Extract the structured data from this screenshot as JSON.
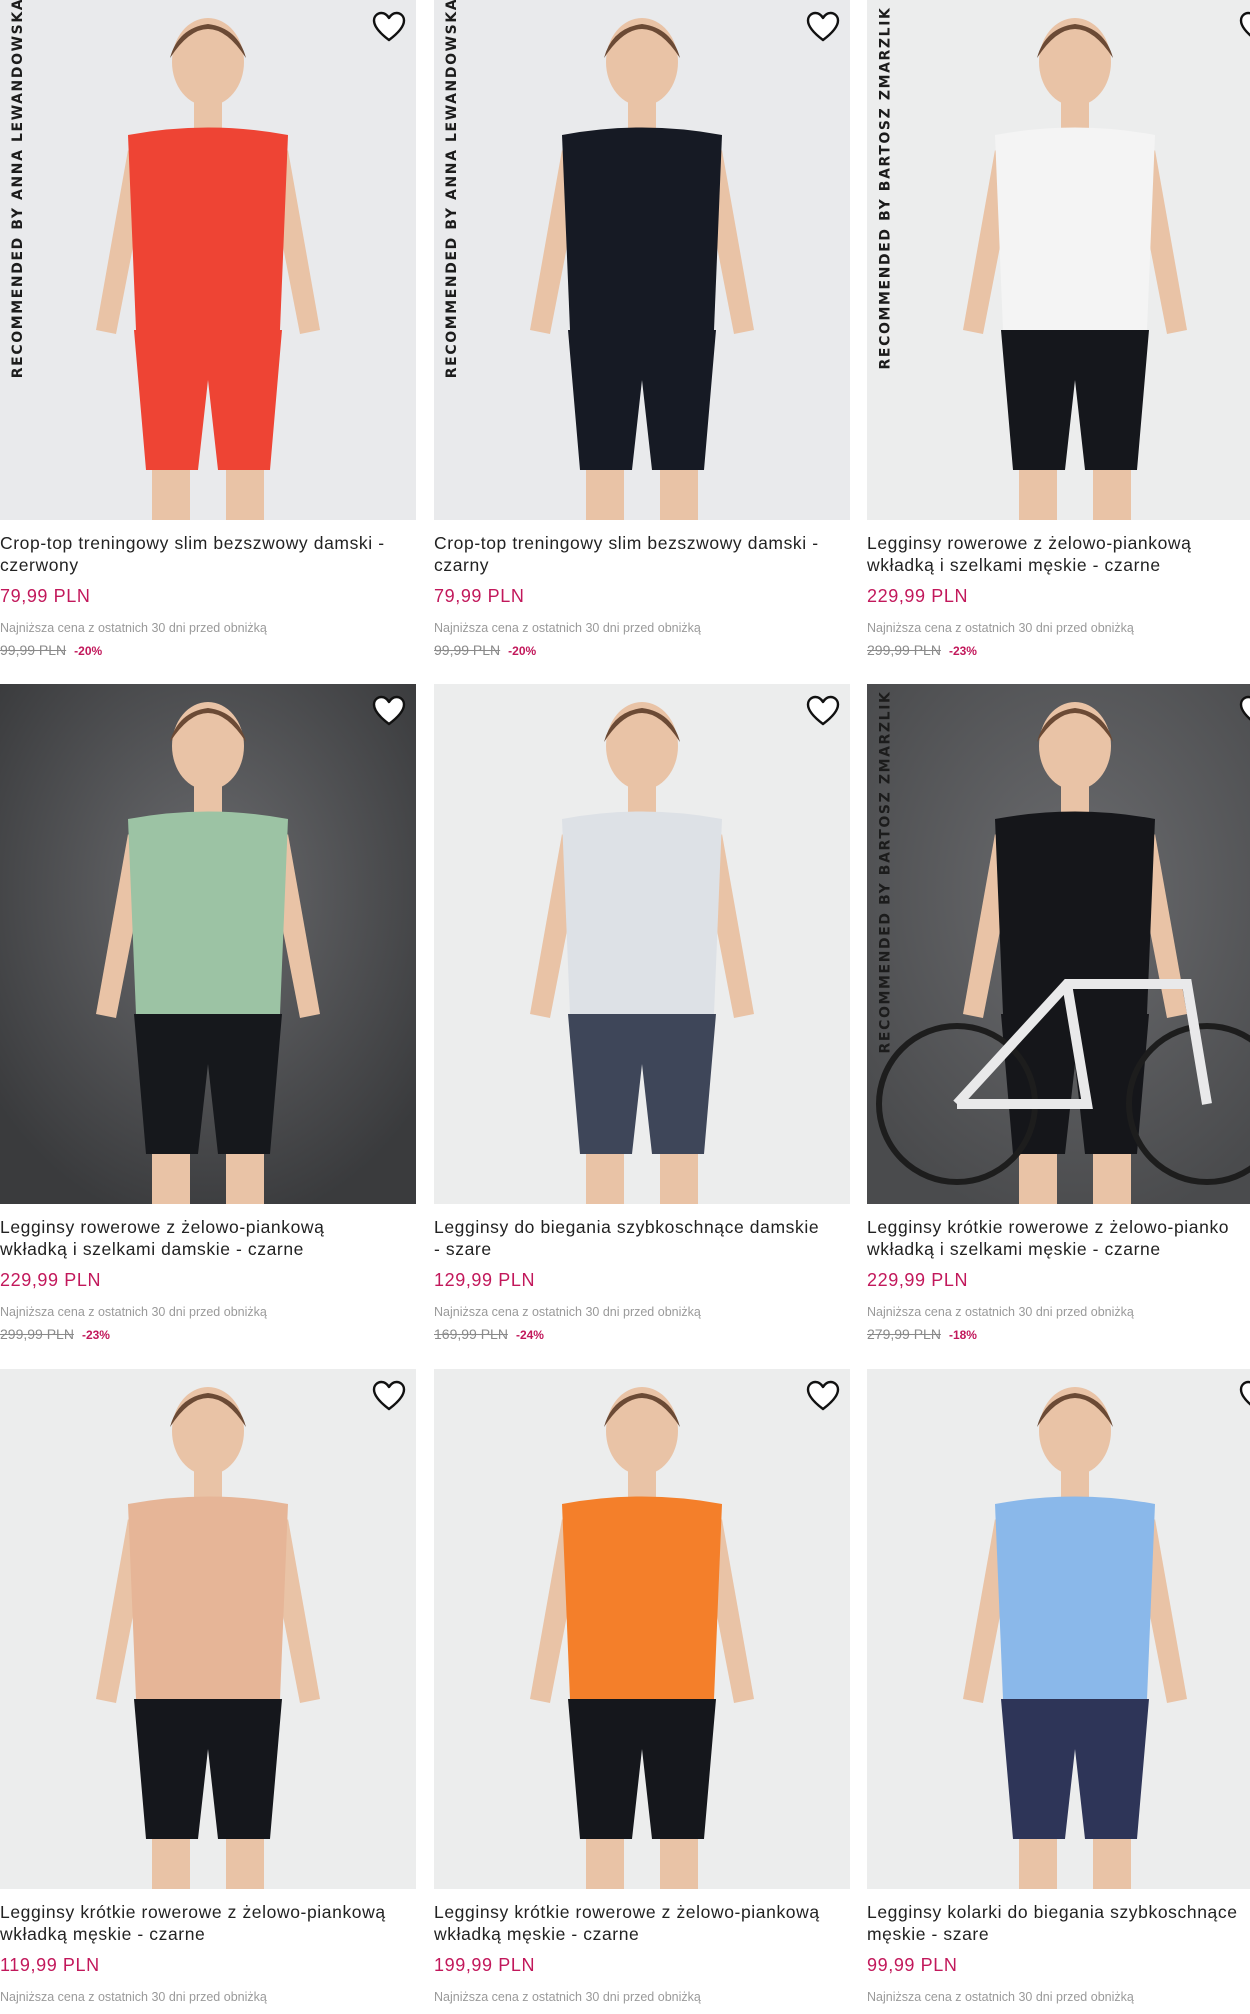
{
  "products": [
    {
      "recommended": "RECOMMENDED BY ANNA LEWANDOWSKA",
      "title_line1": "Crop-top treningowy slim bezszwowy damski -",
      "title_line2": "czerwony",
      "price": "79,99 PLN",
      "lowest_note": "Najniższa cena z ostatnich 30 dni przed obniżką",
      "old_price": "99,99 PLN",
      "discount": "-20%",
      "top_color": "#ee4434",
      "bottom_color": "#ee4434",
      "bg_color": "#e9eaec"
    },
    {
      "recommended": "RECOMMENDED BY ANNA LEWANDOWSKA",
      "title_line1": "Crop-top treningowy slim bezszwowy damski -",
      "title_line2": "czarny",
      "price": "79,99 PLN",
      "lowest_note": "Najniższa cena z ostatnich 30 dni przed obniżką",
      "old_price": "99,99 PLN",
      "discount": "-20%",
      "top_color": "#161a24",
      "bottom_color": "#161a24",
      "bg_color": "#e9eaec"
    },
    {
      "recommended": "RECOMMENDED BY BARTOSZ ZMARZLIK",
      "title_line1": "Legginsy rowerowe z żelowo-piankową",
      "title_line2": "wkładką i szelkami męskie - czarne",
      "price": "229,99 PLN",
      "lowest_note": "Najniższa cena z ostatnich 30 dni przed obniżką",
      "old_price": "299,99 PLN",
      "discount": "-23%",
      "top_color": "#f4f4f4",
      "bottom_color": "#15171c",
      "bg_color": "#eceded"
    },
    {
      "recommended": "",
      "title_line1": "Legginsy rowerowe z żelowo-piankową",
      "title_line2": "wkładką i szelkami damskie - czarne",
      "price": "229,99 PLN",
      "lowest_note": "Najniższa cena z ostatnich 30 dni przed obniżką",
      "old_price": "299,99 PLN",
      "discount": "-23%",
      "top_color": "#9cc3a4",
      "bottom_color": "#16181c",
      "bg_color": "#3a3b3d"
    },
    {
      "recommended": "",
      "title_line1": "Legginsy do biegania szybkoschnące damskie",
      "title_line2": "- szare",
      "price": "129,99 PLN",
      "lowest_note": "Najniższa cena z ostatnich 30 dni przed obniżką",
      "old_price": "169,99 PLN",
      "discount": "-24%",
      "top_color": "#dde1e6",
      "bottom_color": "#3e4659",
      "bg_color": "#eceded"
    },
    {
      "recommended": "RECOMMENDED BY BARTOSZ ZMARZLIK",
      "title_line1": "Legginsy krótkie rowerowe z żelowo-pianko",
      "title_line2": "wkładką i szelkami męskie - czarne",
      "price": "229,99 PLN",
      "lowest_note": "Najniższa cena z ostatnich 30 dni przed obniżką",
      "old_price": "279,99 PLN",
      "discount": "-18%",
      "top_color": "#15161a",
      "bottom_color": "#15161a",
      "bg_color": "#4a4b4d"
    },
    {
      "recommended": "",
      "title_line1": "Legginsy krótkie rowerowe z żelowo-piankową",
      "title_line2": "wkładką męskie - czarne",
      "price": "119,99 PLN",
      "lowest_note": "Najniższa cena z ostatnich 30 dni przed obniżką",
      "old_price": "",
      "discount": "",
      "top_color": "#e6b597",
      "bottom_color": "#15171c",
      "bg_color": "#eceded"
    },
    {
      "recommended": "",
      "title_line1": "Legginsy krótkie rowerowe z żelowo-piankową",
      "title_line2": "wkładką męskie - czarne",
      "price": "199,99 PLN",
      "lowest_note": "Najniższa cena z ostatnich 30 dni przed obniżką",
      "old_price": "",
      "discount": "",
      "top_color": "#f47f2a",
      "bottom_color": "#15171c",
      "bg_color": "#eceded"
    },
    {
      "recommended": "",
      "title_line1": "Legginsy kolarki do biegania szybkoschnące",
      "title_line2": "męskie - szare",
      "price": "99,99 PLN",
      "lowest_note": "Najniższa cena z ostatnich 30 dni przed obniżką",
      "old_price": "",
      "discount": "",
      "top_color": "#8ab8ea",
      "bottom_color": "#2e3558",
      "bg_color": "#eceded"
    }
  ]
}
